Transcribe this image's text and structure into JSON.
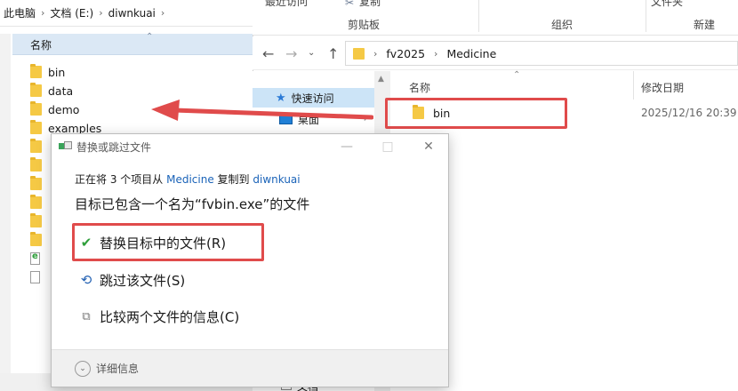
{
  "left_window": {
    "breadcrumb": [
      "此电脑",
      "文档 (E:)",
      "diwnkuai"
    ],
    "column_header": "名称",
    "items": [
      {
        "name": "bin",
        "type": "folder"
      },
      {
        "name": "data",
        "type": "folder"
      },
      {
        "name": "demo",
        "type": "folder"
      },
      {
        "name": "examples",
        "type": "folder"
      },
      {
        "name": "",
        "type": "folder"
      },
      {
        "name": "",
        "type": "folder"
      },
      {
        "name": "",
        "type": "folder"
      },
      {
        "name": "",
        "type": "folder"
      },
      {
        "name": "",
        "type": "folder"
      },
      {
        "name": "",
        "type": "folder"
      },
      {
        "name": "",
        "type": "file-green"
      },
      {
        "name": "",
        "type": "file"
      }
    ]
  },
  "right_window": {
    "ribbon": {
      "recent_label": "最近访问",
      "copy_path_label": "复制",
      "group_clipboard": "剪贴板",
      "group_organize": "组织",
      "group_new": "新建",
      "new_folder_label": "文件夹"
    },
    "address": [
      "fv2025",
      "Medicine"
    ],
    "nav": {
      "quick_access": "快速访问",
      "desktop": "桌面",
      "documents": "文档"
    },
    "columns": {
      "name": "名称",
      "modified": "修改日期"
    },
    "items": [
      {
        "name": "bin",
        "modified": "2025/12/16 20:39"
      }
    ]
  },
  "dialog": {
    "title": "替换或跳过文件",
    "line_prefix": "正在将 3 个项目从",
    "source": "Medicine",
    "line_mid": "复制到",
    "destination": "diwnkuai",
    "heading": "目标已包含一个名为“fvbin.exe”的文件",
    "options": {
      "replace": "替换目标中的文件(R)",
      "skip": "跳过该文件(S)",
      "compare": "比较两个文件的信息(C)"
    },
    "footer": "详细信息"
  },
  "colors": {
    "highlight_red": "#e04b4b",
    "link_blue": "#1a63b8",
    "selection_blue": "#cce4f7",
    "folder_yellow": "#f5c945"
  }
}
